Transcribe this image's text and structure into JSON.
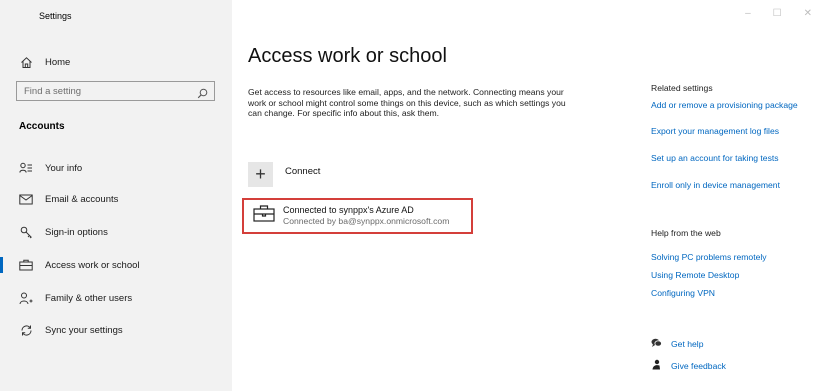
{
  "window": {
    "title": "Settings",
    "controls": [
      "–",
      "☐",
      "✕"
    ]
  },
  "sidebar": {
    "home": "Home",
    "search_placeholder": "Find a setting",
    "section": "Accounts",
    "items": [
      {
        "label": "Your info",
        "icon": "person-list-icon"
      },
      {
        "label": "Email & accounts",
        "icon": "mail-icon"
      },
      {
        "label": "Sign-in options",
        "icon": "key-icon"
      },
      {
        "label": "Access work or school",
        "icon": "briefcase-icon",
        "active": true
      },
      {
        "label": "Family & other users",
        "icon": "person-add-icon"
      },
      {
        "label": "Sync your settings",
        "icon": "sync-icon"
      }
    ]
  },
  "main": {
    "title": "Access work or school",
    "description": "Get access to resources like email, apps, and the network. Connecting means your work or school might control some things on this device, such as which settings you can change. For specific info about this, ask them.",
    "connect_label": "Connect",
    "account": {
      "name": "Connected to synppx's Azure AD",
      "detail": "Connected by ba@synppx.onmicrosoft.com"
    }
  },
  "related": {
    "heading": "Related settings",
    "links": [
      "Add or remove a provisioning package",
      "Export your management log files",
      "Set up an account for taking tests",
      "Enroll only in device management"
    ]
  },
  "help": {
    "heading": "Help from the web",
    "links": [
      "Solving PC problems remotely",
      "Using Remote Desktop",
      "Configuring VPN"
    ]
  },
  "support": {
    "get_help": "Get help",
    "give_feedback": "Give feedback"
  },
  "colors": {
    "accent": "#0067c0",
    "highlight_border": "#d43f3a",
    "sidebar_bg": "#f2f2f2"
  }
}
